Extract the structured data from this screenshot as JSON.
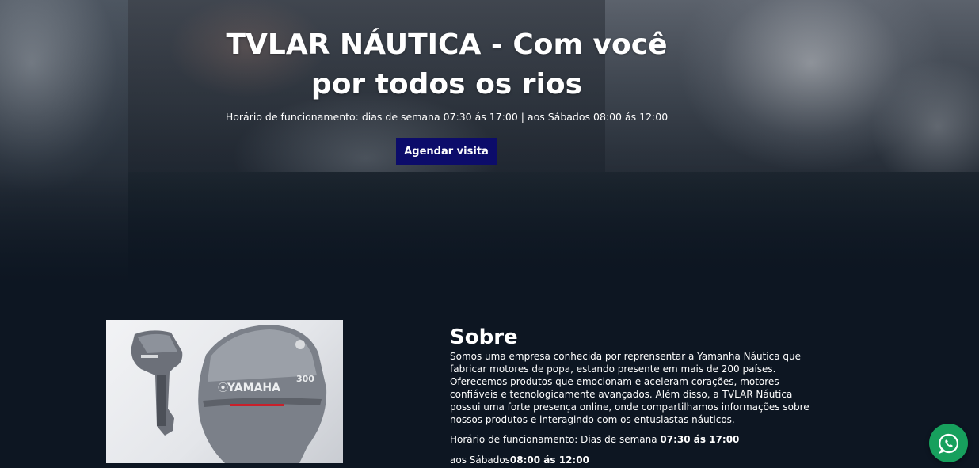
{
  "hero": {
    "title": "TVLAR NÁUTICA - Com você por todos os rios",
    "hours": "Horário de funcionamento: dias de semana 07:30 ás 17:00 | aos Sábados 08:00 ás 12:00",
    "cta_label": "Agendar visita",
    "cta_color": "#0c0c6a"
  },
  "about": {
    "title": "Sobre",
    "description": "Somos uma empresa conhecida por reprensentar a Yamanha Náutica que fabricar motores de popa, estando presente em mais de 200 países. Oferecemos produtos que emocionam e aceleram corações, motores confiáveis e tecnologicamente avançados. Além disso, a TVLAR Náutica possui uma forte presença online, onde compartilhamos informações sobre nossos produtos e interagindo com os entusiastas náuticos.",
    "hours_prefix": "Horário de funcionamento: Dias de semana ",
    "hours_weekday": "07:30 ás 17:00",
    "hours_sat_prefix": "aos Sábados",
    "hours_sat": "08:00 ás 12:00",
    "image_brand": "YAMAHA",
    "image_model": "300"
  },
  "whatsapp": {
    "icon": "whatsapp-icon",
    "color": "#17a05d"
  },
  "colors": {
    "background": "#0d1622",
    "text": "#ffffff"
  }
}
